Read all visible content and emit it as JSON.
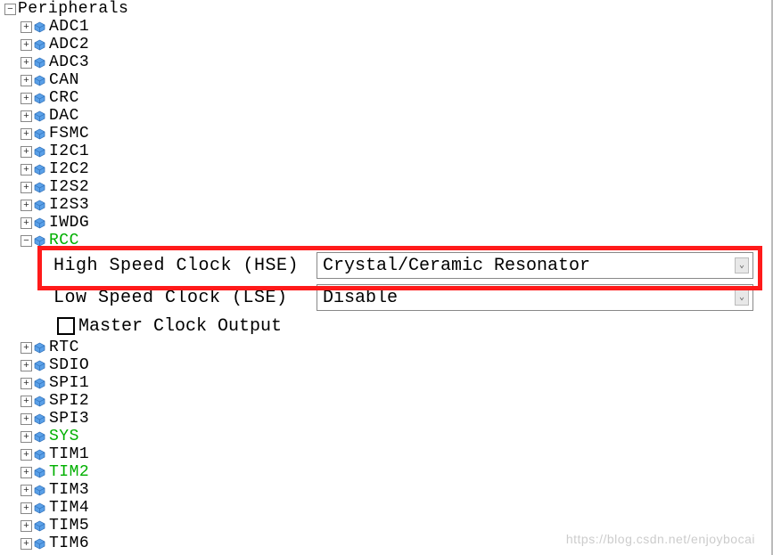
{
  "root": {
    "label": "Peripherals"
  },
  "items": [
    {
      "label": "ADC1",
      "green": false
    },
    {
      "label": "ADC2",
      "green": false
    },
    {
      "label": "ADC3",
      "green": false
    },
    {
      "label": "CAN",
      "green": false
    },
    {
      "label": "CRC",
      "green": false
    },
    {
      "label": "DAC",
      "green": false
    },
    {
      "label": "FSMC",
      "green": false
    },
    {
      "label": "I2C1",
      "green": false
    },
    {
      "label": "I2C2",
      "green": false
    },
    {
      "label": "I2S2",
      "green": false
    },
    {
      "label": "I2S3",
      "green": false
    },
    {
      "label": "IWDG",
      "green": false
    }
  ],
  "rcc": {
    "label": "RCC",
    "hse_label": "High Speed Clock (HSE)",
    "hse_value": "Crystal/Ceramic Resonator",
    "lse_label": "Low Speed Clock (LSE)",
    "lse_value": "Disable",
    "mco_label": "Master Clock Output",
    "mco_checked": false
  },
  "items2": [
    {
      "label": "RTC",
      "green": false
    },
    {
      "label": "SDIO",
      "green": false
    },
    {
      "label": "SPI1",
      "green": false
    },
    {
      "label": "SPI2",
      "green": false
    },
    {
      "label": "SPI3",
      "green": false
    },
    {
      "label": "SYS",
      "green": true
    },
    {
      "label": "TIM1",
      "green": false
    },
    {
      "label": "TIM2",
      "green": true
    },
    {
      "label": "TIM3",
      "green": false
    },
    {
      "label": "TIM4",
      "green": false
    },
    {
      "label": "TIM5",
      "green": false
    },
    {
      "label": "TIM6",
      "green": false
    }
  ],
  "watermark": "https://blog.csdn.net/enjoybocai"
}
